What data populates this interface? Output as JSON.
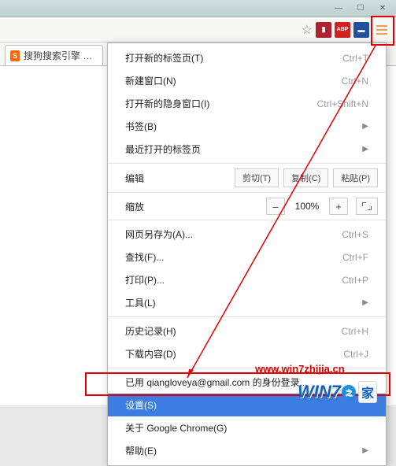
{
  "window": {
    "min": "—",
    "max": "☐",
    "close": "✕"
  },
  "toolbar": {
    "star": "☆",
    "ext1": "▮",
    "ext2": "ABP",
    "ext3": "▬"
  },
  "tab": {
    "favicon": "S",
    "title": "搜狗搜索引擎 - 上..."
  },
  "menu": {
    "new_tab": {
      "label": "打开新的标签页(T)",
      "shortcut": "Ctrl+T"
    },
    "new_window": {
      "label": "新建窗口(N)",
      "shortcut": "Ctrl+N"
    },
    "incognito": {
      "label": "打开新的隐身窗口(I)",
      "shortcut": "Ctrl+Shift+N"
    },
    "bookmarks": {
      "label": "书签(B)"
    },
    "recent": {
      "label": "最近打开的标签页"
    },
    "edit": {
      "label": "编辑",
      "cut": "剪切(T)",
      "copy": "复制(C)",
      "paste": "粘贴(P)"
    },
    "zoom": {
      "label": "缩放",
      "value": "100%",
      "minus": "–",
      "plus": "+"
    },
    "save_as": {
      "label": "网页另存为(A)...",
      "shortcut": "Ctrl+S"
    },
    "find": {
      "label": "查找(F)...",
      "shortcut": "Ctrl+F"
    },
    "print": {
      "label": "打印(P)...",
      "shortcut": "Ctrl+P"
    },
    "tools": {
      "label": "工具(L)"
    },
    "history": {
      "label": "历史记录(H)",
      "shortcut": "Ctrl+H"
    },
    "downloads": {
      "label": "下载内容(D)",
      "shortcut": "Ctrl+J"
    },
    "signed_in": {
      "label": "已用 qiangloveya@gmail.com 的身份登录..."
    },
    "settings": {
      "label": "设置(S)"
    },
    "about": {
      "label": "关于 Google Chrome(G)"
    },
    "help": {
      "label": "帮助(E)"
    }
  },
  "annotation": {
    "url": "www.win7zhijia.cn",
    "logo_w": "W",
    "logo_i": "I",
    "logo_n": "N",
    "logo_7": "7",
    "logo_dot": "●",
    "logo_jia": "家"
  }
}
